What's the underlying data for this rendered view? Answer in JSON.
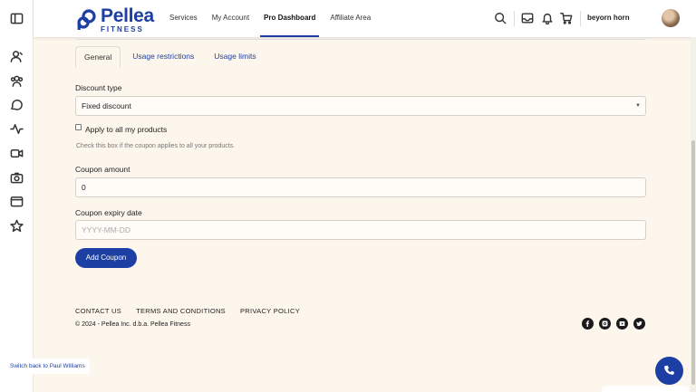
{
  "brand": {
    "name": "Pellea",
    "sub": "FITNESS",
    "color": "#1d3fa3"
  },
  "nav": [
    {
      "label": "Services"
    },
    {
      "label": "My Account"
    },
    {
      "label": "Pro Dashboard",
      "active": true
    },
    {
      "label": "Affiliate Area"
    }
  ],
  "header_icons": [
    "search-icon",
    "inbox-icon",
    "bell-icon",
    "cart-icon"
  ],
  "user": {
    "name": "beyorn horn"
  },
  "sidebar_icons": [
    "panel-toggle-icon",
    "users-icon",
    "group-icon",
    "chat-icon",
    "activity-icon",
    "video-icon",
    "camera-icon",
    "folder-icon",
    "star-icon"
  ],
  "tabs": [
    {
      "label": "General",
      "active": true
    },
    {
      "label": "Usage restrictions"
    },
    {
      "label": "Usage limits"
    }
  ],
  "form": {
    "discount_type_label": "Discount type",
    "discount_type_value": "Fixed discount",
    "apply_all_label": "Apply to all my products",
    "apply_all_help": "Check this box if the coupon applies to all your products.",
    "coupon_amount_label": "Coupon amount",
    "coupon_amount_value": "0",
    "expiry_label": "Coupon expiry date",
    "expiry_placeholder": "YYYY-MM-DD",
    "submit_label": "Add Coupon"
  },
  "footer": {
    "links": [
      "CONTACT US",
      "TERMS AND CONDITIONS",
      "PRIVACY POLICY"
    ],
    "copyright": "© 2024 - Pellea Inc. d.b.a. Pellea Fitness",
    "social_icons": [
      "facebook-icon",
      "instagram-icon",
      "youtube-icon",
      "twitter-icon"
    ]
  },
  "switch_back": "Switch back to Paul Williams"
}
